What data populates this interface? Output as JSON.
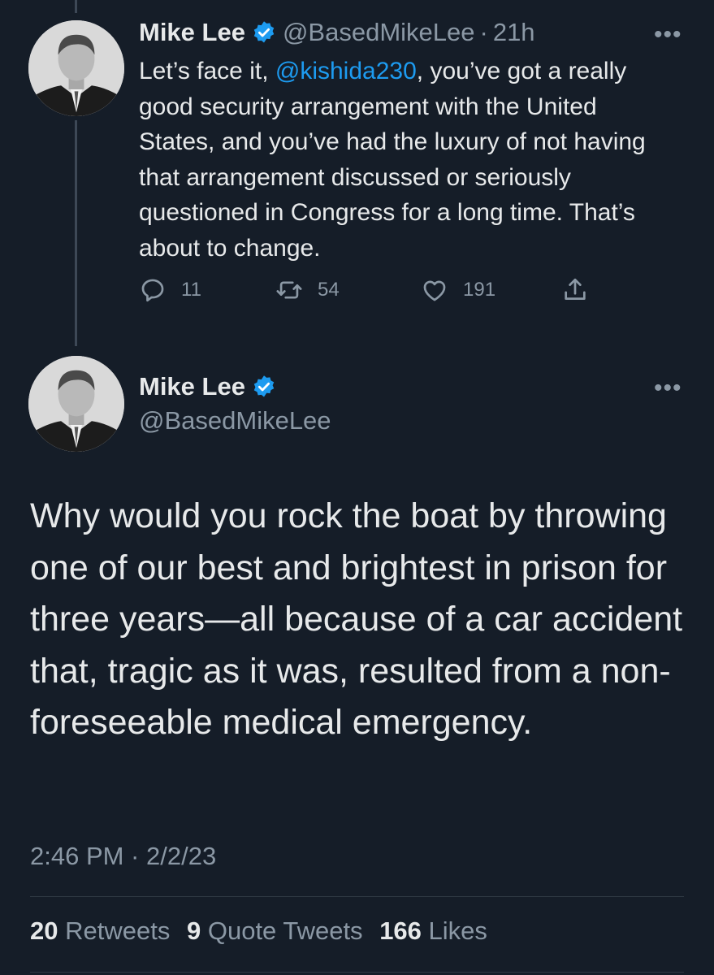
{
  "reply_tweet": {
    "name": "Mike Lee",
    "handle": "@BasedMikeLee",
    "separator": "·",
    "time": "21h",
    "more": "•••",
    "text_before": "Let’s face it, ",
    "mention": "@kishida230",
    "text_after": ", you’ve got a really good security arrangement with the United States, and you’ve had the luxury of not having that arrangement discussed or seriously questioned in Congress for a long time. That’s about to change.",
    "replies": "11",
    "retweets": "54",
    "likes": "191",
    "icons": [
      "reply-icon",
      "retweet-icon",
      "like-icon",
      "share-icon"
    ]
  },
  "main_tweet": {
    "name": "Mike Lee",
    "handle": "@BasedMikeLee",
    "more": "•••",
    "text": "Why would you rock the boat by throwing one of our best and brightest in prison for three years—all because of a car accident that, tragic as it was, resulted from a non-foreseeable medical emergency.",
    "timestamp": "2:46 PM · 2/2/23",
    "retweets_count": "20",
    "retweets_label": "Retweets",
    "quotes_count": "9",
    "quotes_label": "Quote Tweets",
    "likes_count": "166",
    "likes_label": "Likes"
  },
  "colors": {
    "background": "#151d28",
    "text": "#e7e9ea",
    "secondary": "#8b98a5",
    "link": "#1d9bf0",
    "verified": "#1d9bf0"
  }
}
